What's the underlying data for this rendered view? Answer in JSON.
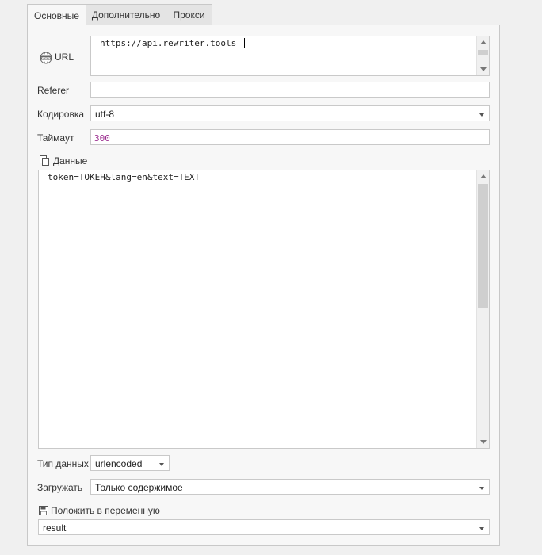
{
  "tabs": [
    {
      "label": "Основные"
    },
    {
      "label": "Дополнительно"
    },
    {
      "label": "Прокси"
    }
  ],
  "form": {
    "url": {
      "label": "URL",
      "value": "https://api.rewriter.tools",
      "icon": "www-globe-icon"
    },
    "referer": {
      "label": "Referer",
      "value": ""
    },
    "encoding": {
      "label": "Кодировка",
      "value": "utf-8"
    },
    "timeout": {
      "label": "Таймаут",
      "value": "300",
      "value_color": "#9b2d8f"
    },
    "data": {
      "label": "Данные",
      "value": "token=TOKEH&lang=en&text=TEXT",
      "icon": "copy-icon"
    },
    "data_type": {
      "label": "Тип данных",
      "value": "urlencoded"
    },
    "load": {
      "label": "Загружать",
      "value": "Только содержимое"
    },
    "save_to_var": {
      "label": "Положить в переменную",
      "value": "result",
      "icon": "floppy-disk-icon"
    }
  },
  "colors": {
    "panel_bg": "#f7f7f7",
    "border": "#c9c9c9",
    "scroll_thumb": "#cfcfcf"
  }
}
